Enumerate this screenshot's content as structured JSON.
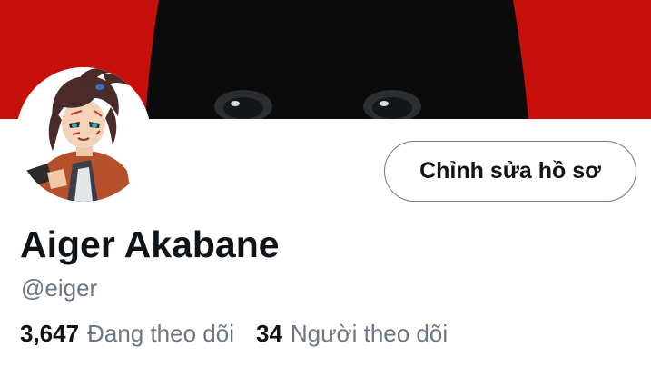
{
  "profile": {
    "display_name": "Aiger Akabane",
    "handle": "@eiger",
    "edit_button_label": "Chỉnh sửa hồ sơ",
    "banner_color": "#c70f0c",
    "avatar_description_icon": "anime-character-avatar"
  },
  "stats": {
    "following_count": "3,647",
    "following_label": "Đang theo dõi",
    "followers_count": "34",
    "followers_label": "Người theo dõi"
  },
  "colors": {
    "primary_text": "#0f1419",
    "secondary_text": "#6b7782",
    "button_border": "#6f7a84"
  }
}
